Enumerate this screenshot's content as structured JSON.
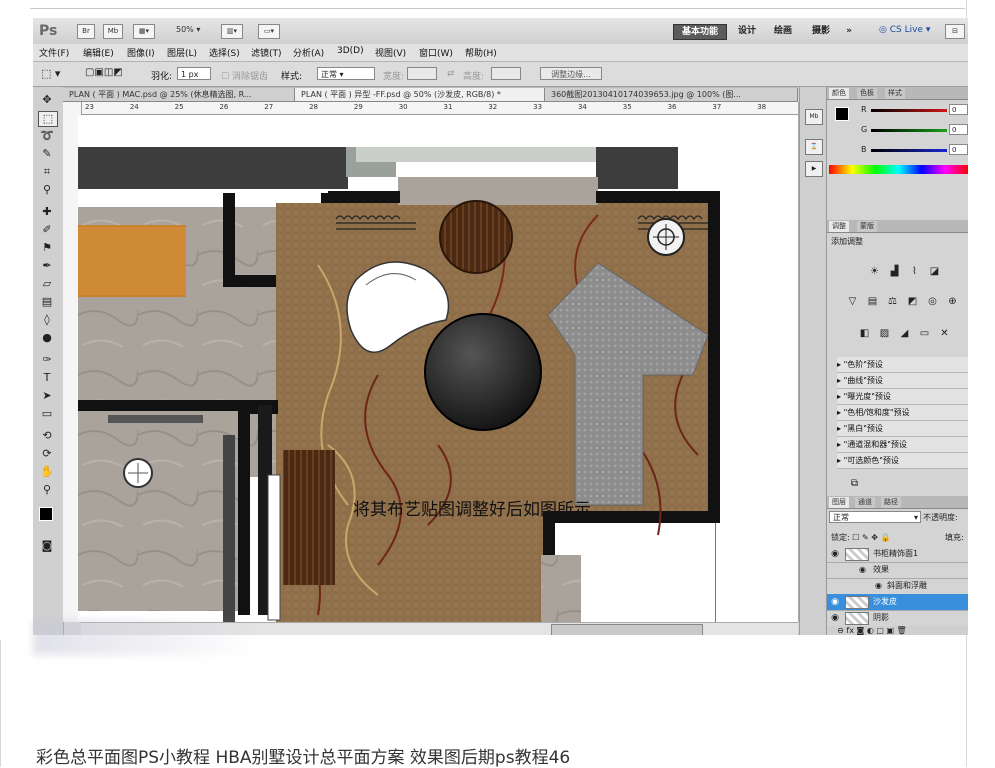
{
  "app": {
    "logo": "Ps",
    "icons": [
      "Br",
      "Mb"
    ],
    "zoom": "50%",
    "workspaces": [
      {
        "label": "基本功能",
        "active": true
      },
      {
        "label": "设计",
        "active": false
      },
      {
        "label": "绘画",
        "active": false
      },
      {
        "label": "摄影",
        "active": false
      },
      {
        "label": "»",
        "active": false
      }
    ],
    "cslive": "CS Live"
  },
  "menu": [
    "文件(F)",
    "编辑(E)",
    "图像(I)",
    "图层(L)",
    "选择(S)",
    "滤镜(T)",
    "分析(A)",
    "3D(D)",
    "视图(V)",
    "窗口(W)",
    "帮助(H)"
  ],
  "options": {
    "feather_label": "羽化:",
    "feather_value": "1 px",
    "antialias_label": "消除锯齿",
    "style_label": "样式:",
    "style_value": "正常",
    "width_label": "宽度:",
    "height_label": "高度:",
    "refine_button": "调整边缘..."
  },
  "tabs": [
    {
      "label": "PLAN ( 平面 ) MAC.psd @ 25% (休息精选图, R...",
      "active": false
    },
    {
      "label": "PLAN ( 平面 ) 异型 -FF.psd @ 50% (沙发皮, RGB/8) *",
      "active": true
    },
    {
      "label": "360截图20130410174039653.jpg @ 100% (图...",
      "active": false
    }
  ],
  "ruler_ticks": [
    "23",
    "24",
    "25",
    "26",
    "27",
    "28",
    "29",
    "30",
    "31",
    "32",
    "33",
    "34",
    "35",
    "36",
    "37",
    "38"
  ],
  "canvas": {
    "annotation": "将其布艺贴图调整好后如图所示",
    "colors": {
      "carpet": "#8f6f4a",
      "walls": "#141414",
      "marble": "#a8a29a",
      "sofa": "#8e8e8e",
      "wood": "#c9832e"
    }
  },
  "panels": {
    "color_tabs": [
      "颜色",
      "色板",
      "样式"
    ],
    "sliders": [
      {
        "label": "R",
        "value": "0",
        "color": "#d01818"
      },
      {
        "label": "G",
        "value": "0",
        "color": "#18a018"
      },
      {
        "label": "B",
        "value": "0",
        "color": "#1828d0"
      }
    ],
    "adjust_tabs": [
      "调整",
      "蒙版"
    ],
    "adjust_title": "添加调整",
    "presets": [
      "\"色阶\"预设",
      "\"曲线\"预设",
      "\"曝光度\"预设",
      "\"色相/饱和度\"预设",
      "\"黑白\"预设",
      "\"通道混和器\"预设",
      "\"可选颜色\"预设"
    ],
    "layer_tabs": [
      "图层",
      "通道",
      "路径"
    ],
    "blend_mode": "正常",
    "opacity_label": "不透明度:",
    "lock_label": "锁定:",
    "fill_label": "填充:",
    "layers": [
      {
        "name": "书柜精饰面1",
        "selected": false
      },
      {
        "name": "效果",
        "selected": false
      },
      {
        "name": "斜面和浮雕",
        "selected": false
      },
      {
        "name": "沙发皮",
        "selected": true
      },
      {
        "name": "阴影",
        "selected": false
      }
    ]
  },
  "caption": "彩色总平面图PS小教程 HBA别墅设计总平面方案 效果图后期ps教程46"
}
